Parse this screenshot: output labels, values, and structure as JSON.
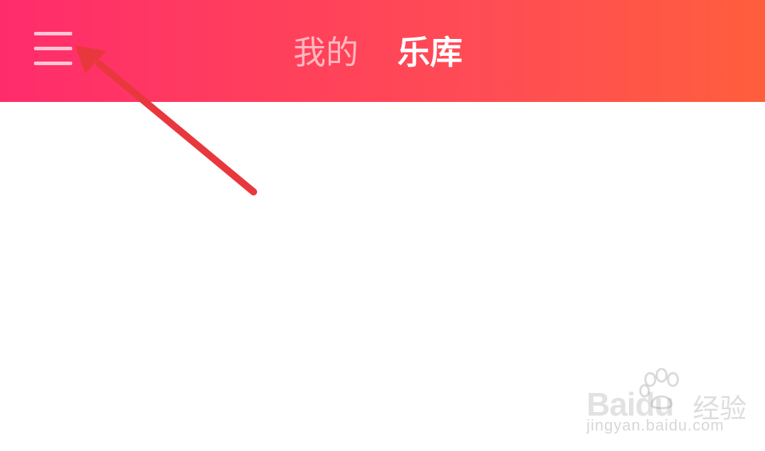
{
  "header": {
    "menu_icon": "hamburger-menu-icon",
    "tabs": [
      {
        "label": "我的",
        "active": false
      },
      {
        "label": "乐库",
        "active": true
      }
    ],
    "gradient_colors": [
      "#ff2c6c",
      "#ff5e3c"
    ]
  },
  "annotation": {
    "arrow_color": "#e8383d"
  },
  "watermark": {
    "logo_text": "Baidu",
    "product_text": "经验",
    "url": "jingyan.baidu.com"
  }
}
